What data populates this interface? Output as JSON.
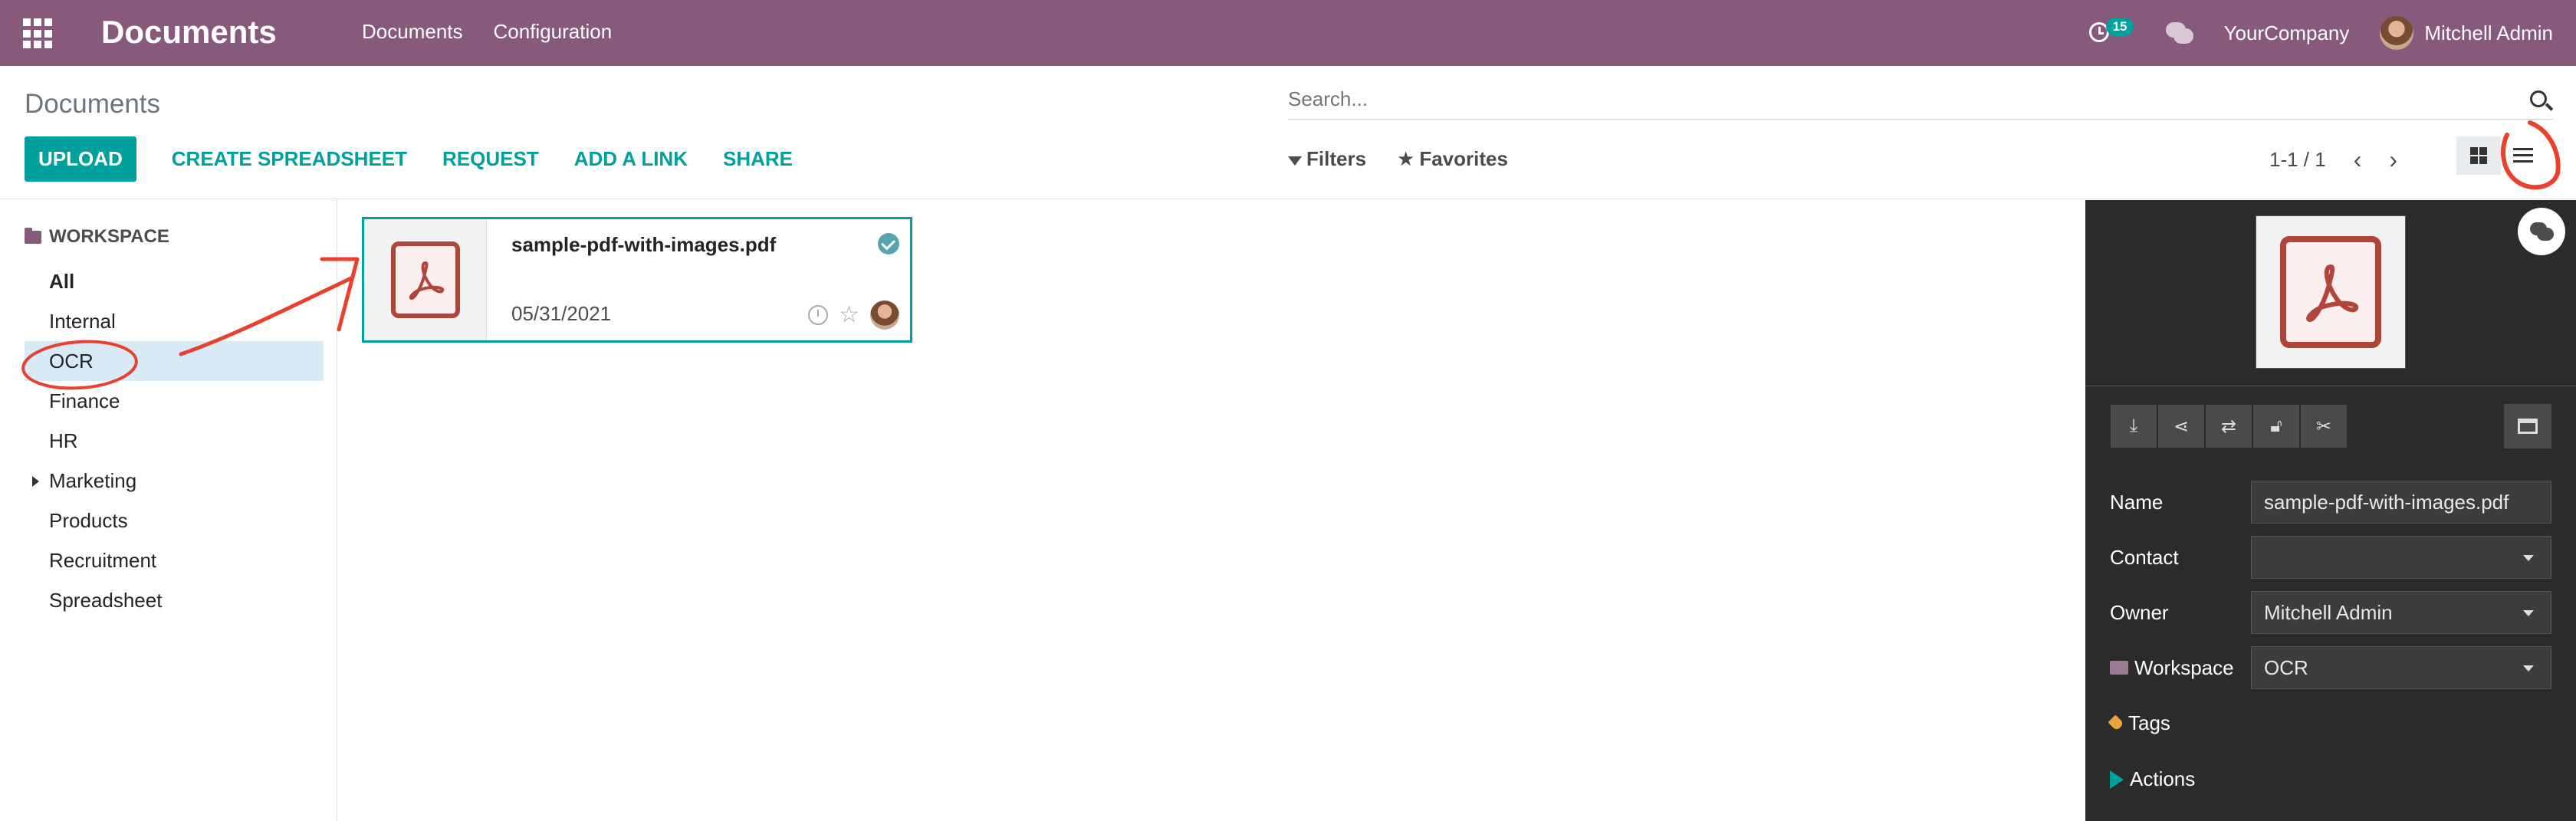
{
  "navbar": {
    "app_title": "Documents",
    "menu": [
      "Documents",
      "Configuration"
    ],
    "activity_count": "15",
    "company": "YourCompany",
    "user": "Mitchell Admin"
  },
  "control": {
    "breadcrumb": "Documents",
    "search_placeholder": "Search...",
    "buttons": {
      "upload": "UPLOAD",
      "create_spreadsheet": "CREATE SPREADSHEET",
      "request": "REQUEST",
      "add_link": "ADD A LINK",
      "share": "SHARE"
    },
    "filters": "Filters",
    "favorites": "Favorites",
    "pager": "1-1 / 1"
  },
  "sidebar": {
    "title": "WORKSPACE",
    "items": [
      {
        "label": "All"
      },
      {
        "label": "Internal"
      },
      {
        "label": "OCR"
      },
      {
        "label": "Finance"
      },
      {
        "label": "HR"
      },
      {
        "label": "Marketing"
      },
      {
        "label": "Products"
      },
      {
        "label": "Recruitment"
      },
      {
        "label": "Spreadsheet"
      }
    ]
  },
  "card": {
    "name": "sample-pdf-with-images.pdf",
    "date": "05/31/2021"
  },
  "panel": {
    "fields": {
      "name_label": "Name",
      "name_value": "sample-pdf-with-images.pdf",
      "contact_label": "Contact",
      "contact_value": "",
      "owner_label": "Owner",
      "owner_value": "Mitchell Admin",
      "workspace_label": "Workspace",
      "workspace_value": "OCR",
      "tags_label": "Tags"
    },
    "actions_label": "Actions"
  },
  "colors": {
    "brand": "#875a7b",
    "accent": "#00a09d",
    "selected_row": "#d9eaf7",
    "panel_bg": "#2b2b2b",
    "annotation": "#e8412f"
  }
}
